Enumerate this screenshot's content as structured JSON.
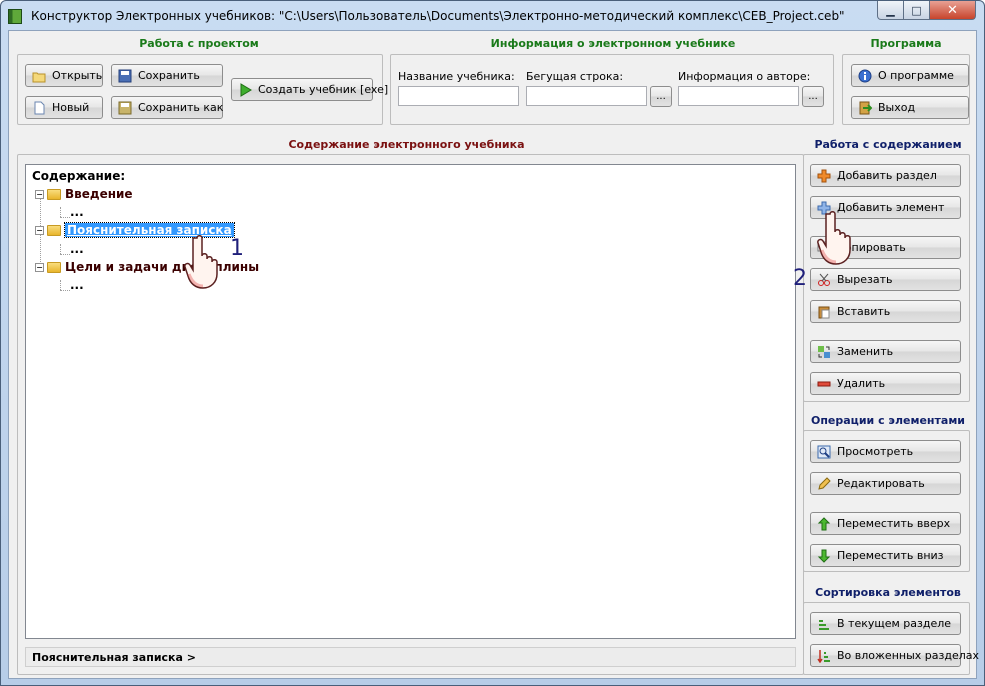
{
  "window": {
    "title": "Конструктор Электронных учебников: \"C:\\Users\\Пользователь\\Documents\\Электронно-методический комплекс\\CEB_Project.ceb\"",
    "min_glyph": "▁",
    "max_glyph": "□",
    "close_glyph": "✕"
  },
  "project_group": {
    "title": "Работа с проектом",
    "open": "Открыть",
    "save": "Сохранить",
    "new": "Новый",
    "save_as": "Сохранить как",
    "build": "Создать учебник [exe]"
  },
  "info_group": {
    "title": "Информация о электронном учебнике",
    "name_label": "Название учебника:",
    "ticker_label": "Бегущая строка:",
    "author_label": "Информация о авторе:",
    "name_value": "",
    "ticker_value": "",
    "author_value": "",
    "browse_label": "..."
  },
  "program_group": {
    "title": "Программа",
    "about": "О программе",
    "exit": "Выход"
  },
  "content": {
    "title": "Содержание электронного учебника",
    "root": "Содержание:",
    "nodes": [
      {
        "label": "Введение",
        "child": "..."
      },
      {
        "label": "Пояснительная записка",
        "child": "..."
      },
      {
        "label": "Цели и задачи дисциплины",
        "child": "..."
      }
    ],
    "status": "Пояснительная записка >"
  },
  "content_ops": {
    "title": "Работа с содержанием",
    "add_section": "Добавить раздел",
    "add_element": "Добавить элемент",
    "copy": "Копировать",
    "cut": "Вырезать",
    "paste": "Вставить",
    "replace": "Заменить",
    "delete": "Удалить"
  },
  "element_ops": {
    "title": "Операции с элементами",
    "view": "Просмотреть",
    "edit": "Редактировать",
    "move_up": "Переместить вверх",
    "move_down": "Переместить вниз"
  },
  "sort_ops": {
    "title": "Сортировка элементов",
    "current_section": "В текущем разделе",
    "nested_sections": "Во вложенных разделах"
  },
  "callouts": {
    "one": "1",
    "two": "2"
  },
  "colors": {
    "group_green": "#1a7a1a",
    "group_maroon": "#7a1010",
    "group_navy": "#10206a",
    "selection": "#3399ff"
  }
}
